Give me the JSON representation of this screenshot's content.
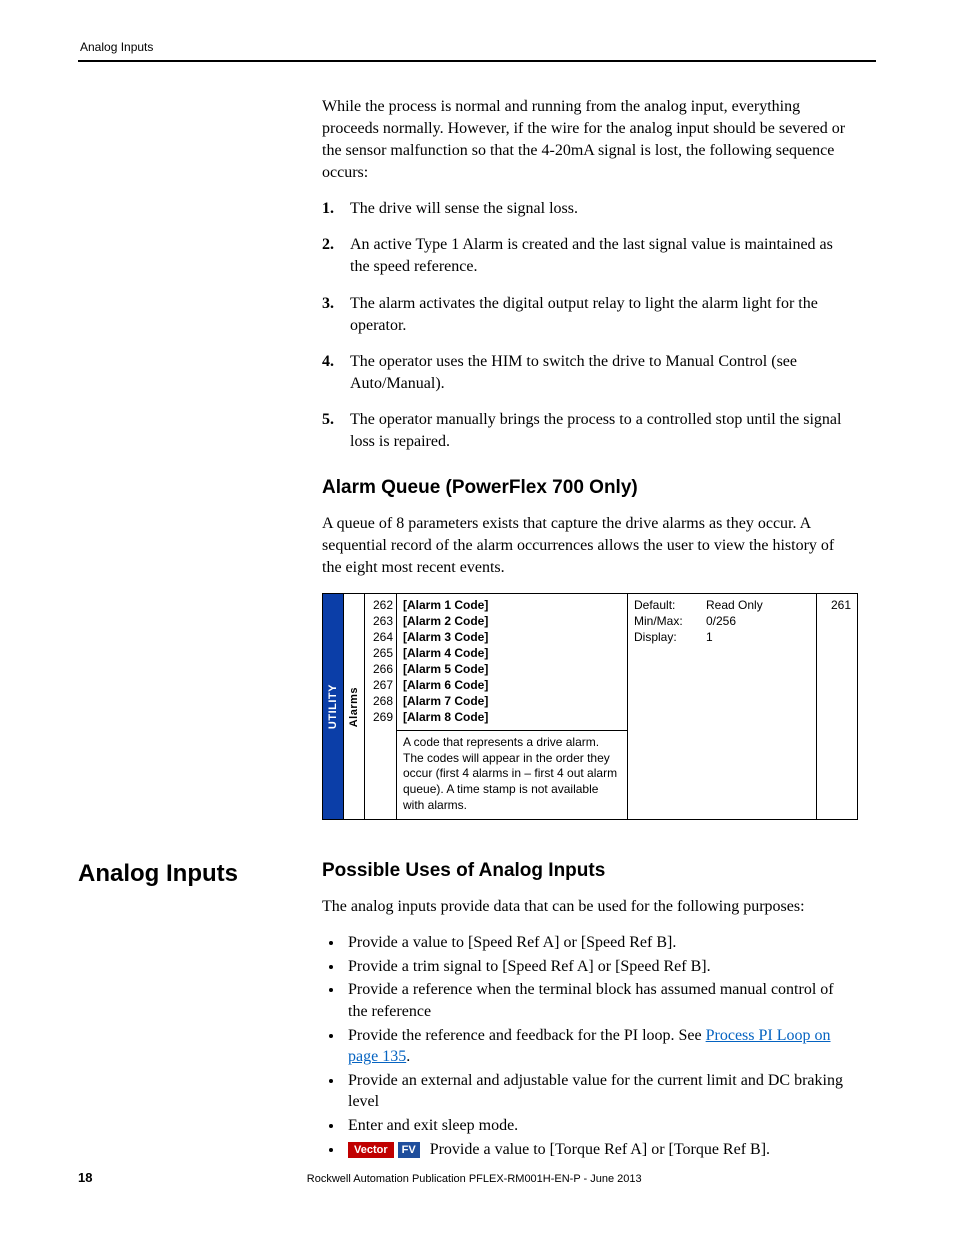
{
  "header": {
    "running": "Analog Inputs"
  },
  "intro_para": "While the process is normal and running from the analog input, everything proceeds normally. However, if the wire for the analog input should be severed or the sensor malfunction so that the 4-20mA signal is lost, the following sequence occurs:",
  "steps": [
    "The drive will sense the signal loss.",
    "An active Type 1 Alarm is created and the last signal value is maintained as the speed reference.",
    "The alarm activates the digital output relay to light the alarm light for the operator.",
    "The operator uses the HIM to switch the drive to Manual Control (see Auto/Manual).",
    "The operator manually brings the process to a controlled stop until the signal loss is repaired."
  ],
  "alarm_section": {
    "heading": "Alarm Queue (PowerFlex 700 Only)",
    "para": "A queue of 8 parameters exists that capture the drive alarms as they occur. A sequential record of the alarm occurrences allows the user to view the history of the eight most recent events."
  },
  "param_table": {
    "group1": "UTILITY",
    "group2": "Alarms",
    "rows": [
      {
        "num": "262",
        "name": "[Alarm 1 Code]"
      },
      {
        "num": "263",
        "name": "[Alarm 2 Code]"
      },
      {
        "num": "264",
        "name": "[Alarm 3 Code]"
      },
      {
        "num": "265",
        "name": "[Alarm 4 Code]"
      },
      {
        "num": "266",
        "name": "[Alarm 5 Code]"
      },
      {
        "num": "267",
        "name": "[Alarm 6 Code]"
      },
      {
        "num": "268",
        "name": "[Alarm 7 Code]"
      },
      {
        "num": "269",
        "name": "[Alarm 8 Code]"
      }
    ],
    "description": "A code that represents a drive alarm. The codes will appear in the order they occur (first 4 alarms in – first 4 out alarm queue). A time stamp is not available with alarms.",
    "meta_labels": {
      "default": "Default:",
      "minmax": "Min/Max:",
      "display": "Display:"
    },
    "meta_values": {
      "default": "Read Only",
      "minmax": "0/256",
      "display": "1"
    },
    "related": "261"
  },
  "analog_section": {
    "side_heading": "Analog Inputs",
    "sub_heading": "Possible Uses of Analog Inputs",
    "lead": "The analog inputs provide data that can be used for the following purposes:",
    "bullets": [
      "Provide a value to [Speed Ref A] or [Speed Ref B].",
      "Provide a trim signal to [Speed Ref A] or [Speed Ref B].",
      "Provide a reference when the terminal block has assumed manual control of the reference",
      {
        "pre": "Provide the reference and feedback for the PI loop. See ",
        "link": "Process PI Loop on page 135",
        "post": "."
      },
      "Provide an external and adjustable value for the current limit and DC braking level",
      "Enter and exit sleep mode.",
      {
        "tags": [
          "Vector",
          "FV"
        ],
        "text": " Provide a value to [Torque Ref A] or [Torque Ref B]."
      }
    ]
  },
  "footer": {
    "page": "18",
    "pub": "Rockwell Automation Publication PFLEX-RM001H-EN-P - June 2013"
  }
}
